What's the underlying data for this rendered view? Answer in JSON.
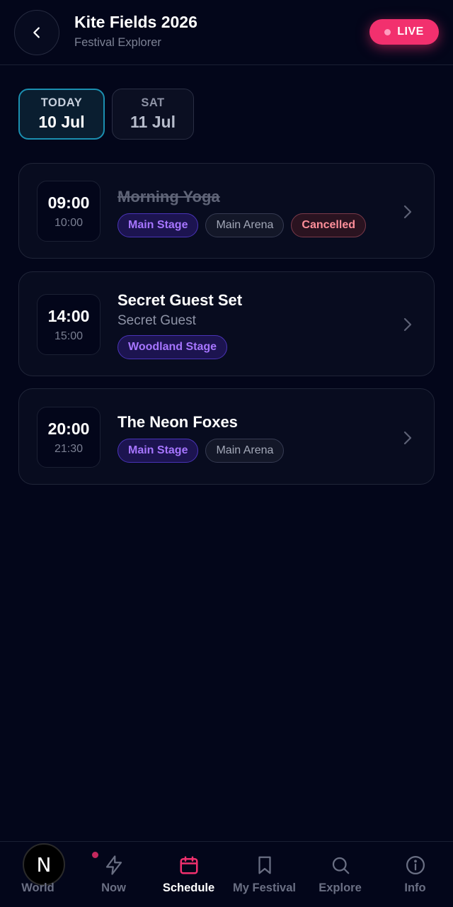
{
  "header": {
    "title": "Kite Fields 2026",
    "subtitle": "Festival Explorer",
    "back_icon": "chevron-left-icon",
    "live_label": "LIVE",
    "live_color": "#f2306e"
  },
  "day_tabs": [
    {
      "top": "TODAY",
      "date": "10 Jul",
      "selected": true
    },
    {
      "top": "SAT",
      "date": "11 Jul",
      "selected": false
    }
  ],
  "events": [
    {
      "start": "09:00",
      "end": "10:00",
      "name": "Morning Yoga",
      "artist": "",
      "cancelled": true,
      "tags": {
        "stage": "Main Stage",
        "venue": "Main Arena",
        "status": "Cancelled"
      }
    },
    {
      "start": "14:00",
      "end": "15:00",
      "name": "Secret Guest Set",
      "artist": "Secret Guest",
      "cancelled": false,
      "tags": {
        "stage": "Woodland Stage"
      }
    },
    {
      "start": "20:00",
      "end": "21:30",
      "name": "The Neon Foxes",
      "artist": "",
      "cancelled": false,
      "tags": {
        "stage": "Main Stage",
        "venue": "Main Arena"
      }
    }
  ],
  "nav": {
    "logo_letter": "N",
    "items": [
      {
        "label": "World",
        "icon": "world-logo-icon"
      },
      {
        "label": "Now",
        "icon": "lightning-icon",
        "notification": true
      },
      {
        "label": "Schedule",
        "icon": "calendar-icon",
        "active": true
      },
      {
        "label": "My Festival",
        "icon": "bookmark-icon"
      },
      {
        "label": "Explore",
        "icon": "search-icon"
      },
      {
        "label": "Info",
        "icon": "info-icon"
      }
    ],
    "active_color": "#f2306e"
  }
}
